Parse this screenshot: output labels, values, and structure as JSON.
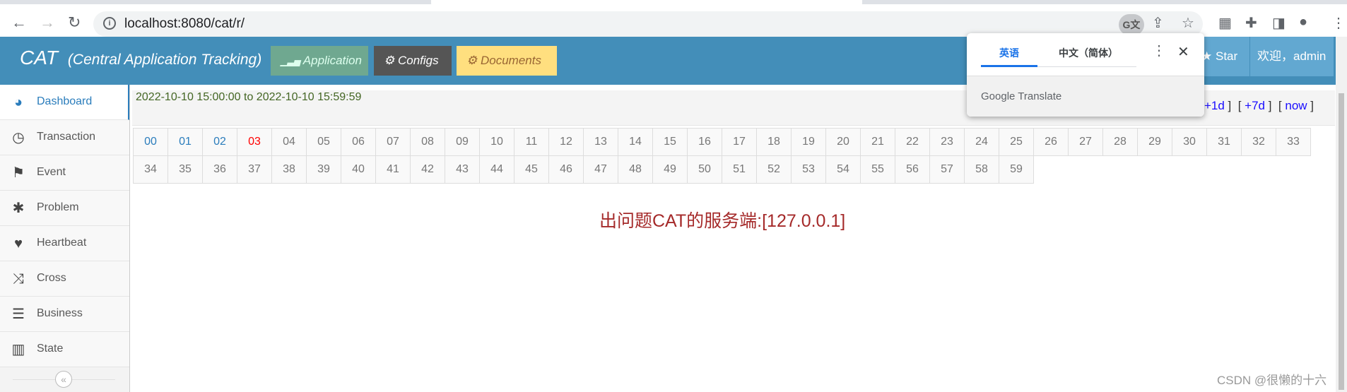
{
  "browser": {
    "url": "localhost:8080/cat/r/"
  },
  "header": {
    "brand": "CAT",
    "subtitle": "(Central Application Tracking)",
    "buttons": [
      {
        "label": "Application",
        "color": "#6fa890"
      },
      {
        "label": "Configs",
        "color": "#555555"
      },
      {
        "label": "Documents",
        "color": "#ffdf7f"
      }
    ],
    "star": "Star",
    "welcome": "欢迎，admin"
  },
  "sidebar": {
    "items": [
      {
        "label": "Dashboard",
        "icon": "dashboard-icon"
      },
      {
        "label": "Transaction",
        "icon": "clock-icon"
      },
      {
        "label": "Event",
        "icon": "flag-icon"
      },
      {
        "label": "Problem",
        "icon": "bug-icon"
      },
      {
        "label": "Heartbeat",
        "icon": "heart-icon"
      },
      {
        "label": "Cross",
        "icon": "random-icon"
      },
      {
        "label": "Business",
        "icon": "list-icon"
      },
      {
        "label": "State",
        "icon": "bar-chart-icon"
      }
    ],
    "collapse": "«"
  },
  "timebar": {
    "range": "2022-10-10 15:00:00 to 2022-10-10 15:59:59",
    "links": [
      "+1d",
      "+7d",
      "now"
    ]
  },
  "minutes": {
    "row1": [
      "00",
      "01",
      "02",
      "03",
      "04",
      "05",
      "06",
      "07",
      "08",
      "09",
      "10",
      "11",
      "12",
      "13",
      "14",
      "15",
      "16",
      "17",
      "18",
      "19",
      "20",
      "21",
      "22",
      "23",
      "24",
      "25",
      "26",
      "27",
      "28",
      "29",
      "30",
      "31",
      "32",
      "33"
    ],
    "row2": [
      "34",
      "35",
      "36",
      "37",
      "38",
      "39",
      "40",
      "41",
      "42",
      "43",
      "44",
      "45",
      "46",
      "47",
      "48",
      "49",
      "50",
      "51",
      "52",
      "53",
      "54",
      "55",
      "56",
      "57",
      "58",
      "59"
    ],
    "current": "03"
  },
  "message": "出问题CAT的服务端:[127.0.0.1]",
  "translate": {
    "tab_source": "英语",
    "tab_target": "中文（简体）",
    "footer": "Google Translate"
  },
  "watermark": "CSDN @很懒的十六"
}
